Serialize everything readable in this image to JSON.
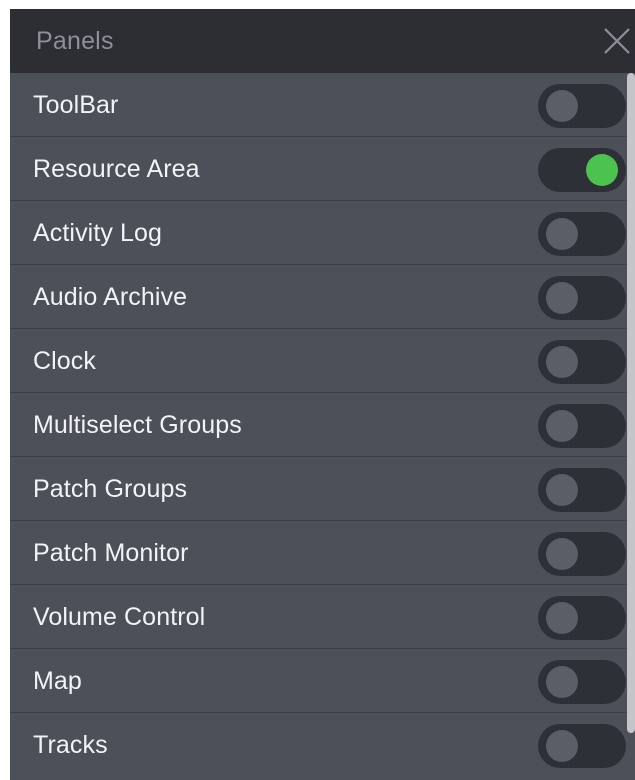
{
  "title": "Panels",
  "close_icon": "close-icon",
  "accent_on_color": "#4cc24f",
  "items": [
    {
      "label": "ToolBar",
      "on": false
    },
    {
      "label": "Resource Area",
      "on": true
    },
    {
      "label": "Activity Log",
      "on": false
    },
    {
      "label": "Audio Archive",
      "on": false
    },
    {
      "label": "Clock",
      "on": false
    },
    {
      "label": "Multiselect Groups",
      "on": false
    },
    {
      "label": "Patch Groups",
      "on": false
    },
    {
      "label": "Patch Monitor",
      "on": false
    },
    {
      "label": "Volume Control",
      "on": false
    },
    {
      "label": "Map",
      "on": false
    },
    {
      "label": "Tracks",
      "on": false
    }
  ]
}
